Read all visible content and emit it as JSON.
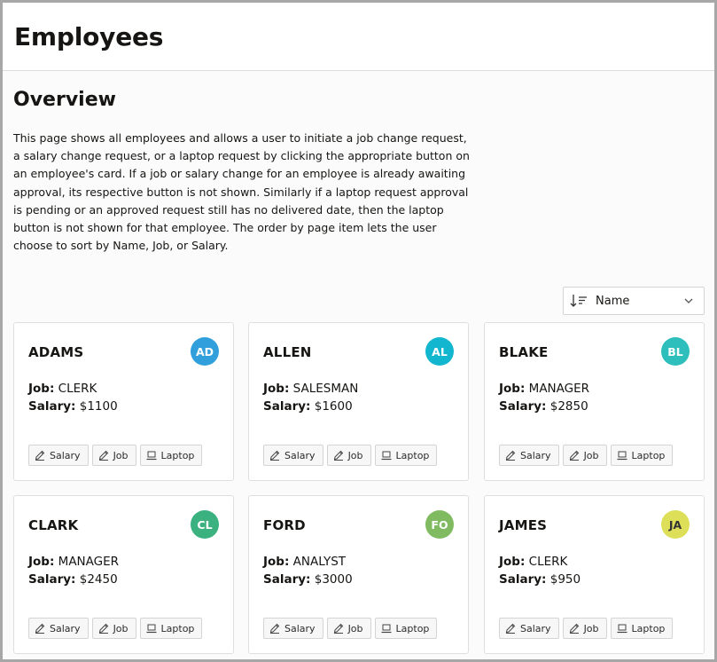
{
  "header": {
    "title": "Employees"
  },
  "overview": {
    "title": "Overview",
    "text": "This page shows all employees and allows a user to initiate a job change request, a salary change request, or a laptop request by clicking the appropriate button on an employee's card. If a job or salary change for an employee is already awaiting approval, its respective button is not shown. Similarly if a laptop request approval is pending or an approved request still has no delivered date, then the laptop button is not shown for that employee. The order by page item lets the user choose to sort by Name, Job, or Salary."
  },
  "order_by": {
    "value": "Name",
    "icon": "sort-icon"
  },
  "labels": {
    "job": "Job:",
    "salary": "Salary:"
  },
  "buttons": {
    "salary": "Salary",
    "job": "Job",
    "laptop": "Laptop"
  },
  "employees": [
    {
      "name": "ADAMS",
      "initials": "AD",
      "job": "CLERK",
      "salary": "$1100",
      "color": "#309fdb"
    },
    {
      "name": "ALLEN",
      "initials": "AL",
      "job": "SALESMAN",
      "salary": "$1600",
      "color": "#13b6cf"
    },
    {
      "name": "BLAKE",
      "initials": "BL",
      "job": "MANAGER",
      "salary": "$2850",
      "color": "#2ebfbc"
    },
    {
      "name": "CLARK",
      "initials": "CL",
      "job": "MANAGER",
      "salary": "$2450",
      "color": "#3cb180"
    },
    {
      "name": "FORD",
      "initials": "FO",
      "job": "ANALYST",
      "salary": "$3000",
      "color": "#80bb62"
    },
    {
      "name": "JAMES",
      "initials": "JA",
      "job": "CLERK",
      "salary": "$950",
      "color": "#dcdf57"
    }
  ]
}
